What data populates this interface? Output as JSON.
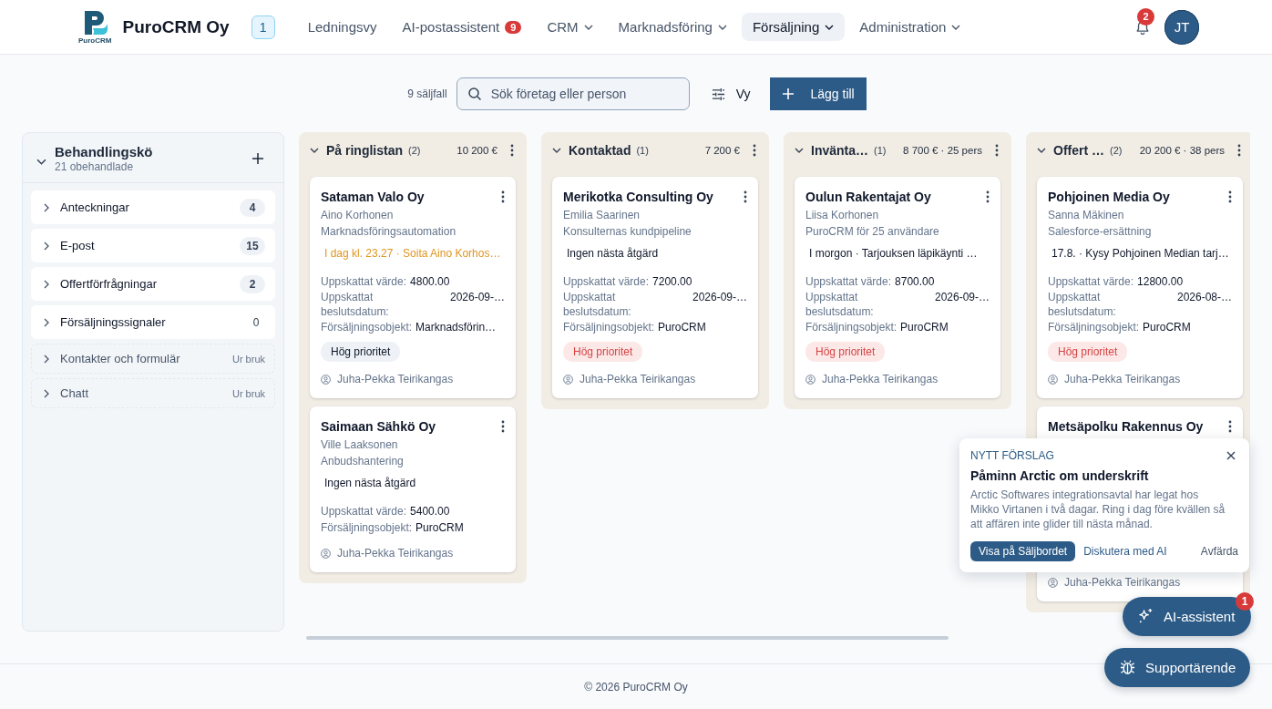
{
  "header": {
    "logo_text": "PuroCRM",
    "company": "PuroCRM Oy",
    "company_badge": "1",
    "nav": [
      {
        "label": "Ledningsvy",
        "selected": false,
        "dropdown": false
      },
      {
        "label": "AI-postassistent",
        "selected": false,
        "dropdown": false,
        "badge": "9"
      },
      {
        "label": "CRM",
        "selected": false,
        "dropdown": true
      },
      {
        "label": "Marknadsföring",
        "selected": false,
        "dropdown": true
      },
      {
        "label": "Försäljning",
        "selected": true,
        "dropdown": true
      },
      {
        "label": "Administration",
        "selected": false,
        "dropdown": true
      }
    ],
    "notifications": "2",
    "avatar": "JT"
  },
  "toolbar": {
    "count": "9 säljfall",
    "search": {
      "placeholder": "Sök företag eller person"
    },
    "view_button": "Vy",
    "add_button": "Lägg till"
  },
  "queue": {
    "title": "Behandlingskö",
    "subtitle": "21 obehandlade",
    "items": [
      {
        "label": "Anteckningar",
        "count": "4",
        "badge": true,
        "disabled": false
      },
      {
        "label": "E-post",
        "count": "15",
        "badge": true,
        "disabled": false
      },
      {
        "label": "Offertförfrågningar",
        "count": "2",
        "badge": true,
        "disabled": false
      },
      {
        "label": "Försäljningssignaler",
        "count": "0",
        "badge": false,
        "disabled": false
      },
      {
        "label": "Kontakter och formulär",
        "count": "Ur bruk",
        "badge": false,
        "disabled": true
      },
      {
        "label": "Chatt",
        "count": "Ur bruk",
        "badge": false,
        "disabled": true
      }
    ]
  },
  "columns": [
    {
      "title": "På ringlistan",
      "count": "(2)",
      "total": "10 200 €",
      "cards": [
        {
          "company": "Sataman Valo Oy",
          "contact": "Aino Korhonen",
          "product": "Marknadsföringsautomation",
          "next": {
            "text": "I dag kl. 23.27 · Soita Aino Korhos…",
            "overdue": true
          },
          "fields": [
            {
              "label": "Uppskattat värde:",
              "value": "4800.00",
              "kind": "inline"
            },
            {
              "label": "Uppskattat beslutsdatum:",
              "value": "2026-09-…",
              "kind": "split"
            },
            {
              "label": "Försäljningsobjekt:",
              "value": "Marknadsförin…",
              "kind": "inline"
            }
          ],
          "tag": {
            "text": "Hög prioritet",
            "alert": false
          },
          "owner": "Juha-Pekka Teirikangas"
        },
        {
          "company": "Saimaan Sähkö Oy",
          "contact": "Ville Laaksonen",
          "product": "Anbudshantering",
          "next": {
            "text": "Ingen nästa åtgärd",
            "overdue": false
          },
          "fields": [
            {
              "label": "Uppskattat värde:",
              "value": "5400.00",
              "kind": "inline"
            },
            {
              "label": "Försäljningsobjekt:",
              "value": "PuroCRM",
              "kind": "inline"
            }
          ],
          "owner": "Juha-Pekka Teirikangas"
        }
      ]
    },
    {
      "title": "Kontaktad",
      "count": "(1)",
      "total": "7 200 €",
      "cards": [
        {
          "company": "Merikotka Consulting Oy",
          "contact": "Emilia Saarinen",
          "product": "Konsulternas kundpipeline",
          "next": {
            "text": "Ingen nästa åtgärd",
            "overdue": false
          },
          "fields": [
            {
              "label": "Uppskattat värde:",
              "value": "7200.00",
              "kind": "inline"
            },
            {
              "label": "Uppskattat beslutsdatum:",
              "value": "2026-09-…",
              "kind": "split"
            },
            {
              "label": "Försäljningsobjekt:",
              "value": "PuroCRM",
              "kind": "inline"
            }
          ],
          "tag": {
            "text": "Hög prioritet",
            "alert": true
          },
          "owner": "Juha-Pekka Teirikangas"
        }
      ]
    },
    {
      "title": "Invänta…",
      "count": "(1)",
      "total": "8 700 € · 25 pers",
      "cards": [
        {
          "company": "Oulun Rakentajat Oy",
          "contact": "Liisa Korhonen",
          "product": "PuroCRM för 25 användare",
          "next": {
            "text": "I morgon · Tarjouksen läpikäynti …",
            "overdue": false
          },
          "fields": [
            {
              "label": "Uppskattat värde:",
              "value": "8700.00",
              "kind": "inline"
            },
            {
              "label": "Uppskattat beslutsdatum:",
              "value": "2026-09-…",
              "kind": "split"
            },
            {
              "label": "Försäljningsobjekt:",
              "value": "PuroCRM",
              "kind": "inline"
            }
          ],
          "tag": {
            "text": "Hög prioritet",
            "alert": true
          },
          "owner": "Juha-Pekka Teirikangas"
        }
      ]
    },
    {
      "title": "Offert …",
      "count": "(2)",
      "total": "20 200 € · 38 pers",
      "cards": [
        {
          "company": "Pohjoinen Media Oy",
          "contact": "Sanna Mäkinen",
          "product": "Salesforce-ersättning",
          "next": {
            "text": "17.8. · Kysy Pohjoinen Median tarj…",
            "overdue": false
          },
          "fields": [
            {
              "label": "Uppskattat värde:",
              "value": "12800.00",
              "kind": "inline"
            },
            {
              "label": "Uppskattat beslutsdatum:",
              "value": "2026-08-…",
              "kind": "split"
            },
            {
              "label": "Försäljningsobjekt:",
              "value": "PuroCRM",
              "kind": "inline"
            }
          ],
          "tag": {
            "text": "Hög prioritet",
            "alert": true
          },
          "owner": "Juha-Pekka Teirikangas"
        },
        {
          "company": "Metsäpolku Rakennus Oy",
          "owner": "Juha-Pekka Teirikangas"
        }
      ]
    }
  ],
  "suggestion": {
    "overline": "NYTT FÖRSLAG",
    "title": "Påminn Arctic om underskrift",
    "body": "Arctic Softwares integrationsavtal har legat hos Mikko Virtanen i två dagar. Ring i dag före kvällen så att affären inte glider till nästa månad.",
    "primary": "Visa på Säljbordet",
    "secondary": "Diskutera med AI",
    "dismiss": "Avfärda"
  },
  "ai_button": {
    "label": "AI-assistent",
    "badge": "1"
  },
  "support_button": {
    "label": "Supportärende"
  },
  "footer": "© 2026 PuroCRM Oy"
}
